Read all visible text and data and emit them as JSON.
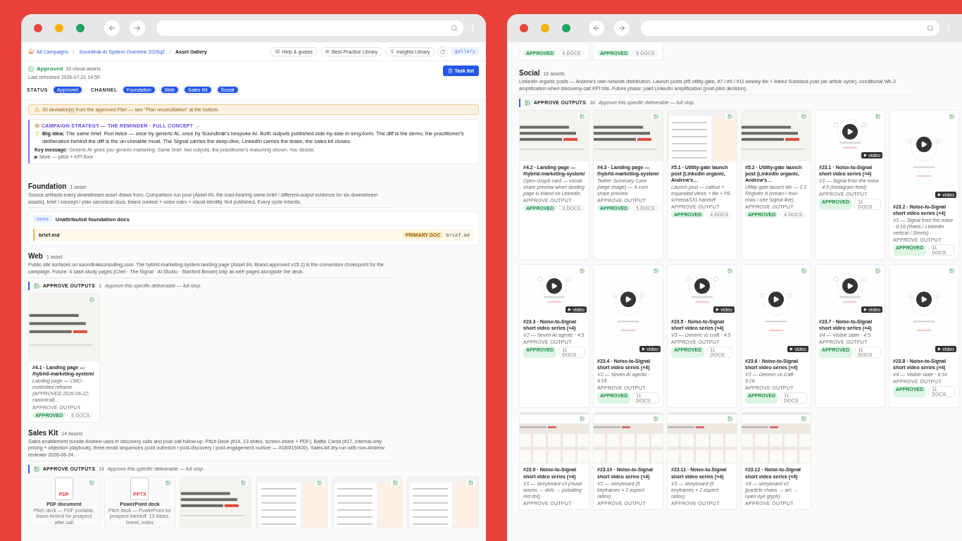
{
  "left_window": {
    "breadcrumbs": [
      "All Campaigns",
      "Soundtrak AI System Overview 2026q2",
      "Asset Gallery"
    ],
    "toolbar_links": [
      "Help & guides",
      "Best-Practice Library",
      "Insights Library"
    ],
    "view_tag": "gallery",
    "status": {
      "label": "Approved",
      "count": "33 visual assets",
      "refreshed": "Last refreshed 2026-07-21 14:50"
    },
    "task_button": "Task list",
    "filters": [
      {
        "label": "STATUS",
        "chips": [
          {
            "label": "Approved",
            "selected": true
          }
        ]
      },
      {
        "label": "CHANNEL",
        "chips": [
          {
            "label": "Foundation",
            "selected": true
          },
          {
            "label": "Web",
            "selected": true
          },
          {
            "label": "Sales Kit",
            "selected": true
          },
          {
            "label": "Social",
            "selected": true
          }
        ]
      }
    ],
    "warning": "30 deviation(s) from the approved Plan — see \"Plan reconciliation\" at the bottom.",
    "strategy": {
      "title": "CAMPAIGN STRATEGY — THE REMINDER · FULL CONCEPT →",
      "big_idea": "**Big idea:** The same brief. Run twice — once by generic AI, once by Soundtrak's bespoke AI. Both outputs published side-by-side in long-form. The diff is the demo; the practitioner's deliberation behind the diff is the un-clonable moat. The Signal carries the deep-dive, LinkedIn carries the tease, the sales kit closes.",
      "key_message": "**Key message:** Generic AI gives you generic marketing. Same brief, two outputs, the practitioner's reasoning shown. You decide.",
      "more": "▶ More — pitch + KPI floor"
    },
    "sections": [
      {
        "title": "Foundation",
        "count": "1 asset",
        "description": "Source artifacts every downstream asset draws from. Comparison run pool (Asset #0, the load-bearing same-brief / different-output evidence for six downstream assets), brief / concept / plan canonical docs, brand context + voice rules + visual identity. Not published. Every cycle inherits.",
        "group": {
          "tag": "none",
          "title": "Unattributed foundation docs",
          "docs": [
            {
              "name": "brief.md",
              "tag": "PRIMARY DOC",
              "file": "brief.md"
            }
          ]
        }
      },
      {
        "title": "Web",
        "count": "1 asset",
        "description": "Public site surfaces on soundtrakconsulting.com. The hybrid-marketing-system landing page (Asset #4, Brand-approved v15.1) is the conversion chokepoint for the campaign. Future: 4 case-study pages (Chef · The Signal · AI Studio · Stanford Brown) ship as web pages alongside the deck.",
        "approve": {
          "label": "APPROVE OUTPUTS",
          "count": "1",
          "note": "Approve this specific deliverable — full stop."
        },
        "cards": [
          {
            "kind": "page",
            "tall": true,
            "title": "#4.1 · Landing page — /hybrid-marketing-system/",
            "subtitle": "Landing page — CMO-controlled reframe (APPROVED 2026-06-22; canonical)…",
            "action": "APPROVE OUTPUT",
            "status": "APPROVED",
            "docs": "6 DOCS"
          }
        ]
      },
      {
        "title": "Sales Kit",
        "count": "14 assets",
        "description": "Sales-enablement bundle Andrew uses in discovery calls and post-call follow-up. Pitch Deck (#14, 13 slides, screen-share + PDF), Battle Cards (#17, internal-only pricing + objection playbook), three email sequences (cold outreach / post-discovery / post-engagement nurture — #18/#19/#20). Sales-kit dry-run with non-Andrew reviewer 2026-06-24.",
        "approve": {
          "label": "APPROVE OUTPUTS",
          "count": "14",
          "note": "Approve this specific deliverable — full stop."
        },
        "cards": [
          {
            "kind": "file",
            "file_type": "PDF",
            "file_label": "PDF document",
            "file_note": "Pitch deck — PDF portable, leave-behind for prospect after call"
          },
          {
            "kind": "file",
            "file_type": "PPTX",
            "file_label": "PowerPoint deck",
            "file_note": "Pitch deck — PowerPoint for prospect handoff; 13 slides, brand, notes"
          },
          {
            "kind": "page"
          },
          {
            "kind": "doc"
          },
          {
            "kind": "doc"
          },
          {
            "kind": "doc"
          }
        ]
      }
    ]
  },
  "right_window": {
    "top_cards": [
      {
        "status": "APPROVED",
        "docs": "4 DOCS"
      },
      {
        "status": "APPROVED",
        "docs": "6 DOCS"
      }
    ],
    "sections": [
      {
        "title": "Social",
        "count": "16 assets",
        "description": "LinkedIn organic posts — Andrew's own network distribution. Launch posts (#5 utility-gate, #7 / #9 / #11 weekly tile + linked Substack post per article cycle), conditional Wk-3 amplification when discovery-call KPI hits. Future phase: paid LinkedIn amplification (post-pilot decision).",
        "approve": {
          "label": "APPROVE OUTPUTS",
          "count": "16",
          "note": "Approve this specific deliverable — full stop."
        },
        "cards": [
          {
            "kind": "page",
            "title": "#4.2 · Landing page — /hybrid-marketing-system/",
            "subtitle": "Open Graph card — social-share preview when landing page is linked on LinkedIn.",
            "action": "APPROVE OUTPUT",
            "status": "APPROVED",
            "docs": "3 DOCS"
          },
          {
            "kind": "page",
            "title": "#4.3 · Landing page — /hybrid-marketing-system/",
            "subtitle": "Twitter Summary Card (large image) — X.com share preview",
            "action": "APPROVE OUTPUT",
            "status": "APPROVED",
            "docs": "5 DOCS"
          },
          {
            "kind": "doc",
            "title": "#5.1 · Utility-gate launch post (LinkedIn organic, Andrew's…",
            "subtitle": "Launch post — callout + expanded views + tile + PE schema/OG handoff",
            "action": "APPROVE OUTPUT",
            "status": "APPROVED",
            "docs": "4 DOCS"
          },
          {
            "kind": "page",
            "title": "#5.2 · Utility-gate launch post (LinkedIn organic, Andrew's…",
            "subtitle": "Utility-gate launch tile — 1:1 Register A (cream / four-rows / one Signal line)",
            "action": "APPROVE OUTPUT",
            "status": "APPROVED",
            "docs": "4 DOCS"
          },
          {
            "kind": "video",
            "video_label": "video",
            "title": "#23.1 · Noise-to-Signal short video series (×4)",
            "subtitle": "V1 — Signal from the noise · 4:5 (Instagram feed)",
            "action": "APPROVE OUTPUT",
            "status": "APPROVED",
            "docs": "11 DOCS"
          },
          {
            "kind": "video",
            "tall": true,
            "video_label": "video",
            "title": "#23.2 · Noise-to-Signal short video series (×4)",
            "subtitle": "V1 — Signal from the noise · 9:16 (Reels / LinkedIn vertical / Shorts)",
            "action": "APPROVE OUTPUT",
            "status": "APPROVED",
            "docs": "11 DOCS"
          },
          {
            "kind": "video",
            "video_label": "video",
            "title": "#23.3 · Noise-to-Signal short video series (×4)",
            "subtitle": "V2 — Seven AI agents · 4:5",
            "action": "APPROVE OUTPUT",
            "status": "APPROVED",
            "docs": "11 DOCS"
          },
          {
            "kind": "video",
            "tall": true,
            "video_label": "video",
            "title": "#23.4 · Noise-to-Signal short video series (×4)",
            "subtitle": "V2 — Seven AI agents · 9:16",
            "action": "APPROVE OUTPUT",
            "status": "APPROVED",
            "docs": "11 DOCS"
          },
          {
            "kind": "video",
            "video_label": "video",
            "title": "#23.5 · Noise-to-Signal short video series (×4)",
            "subtitle": "V3 — Generic vs craft · 4:5",
            "action": "APPROVE OUTPUT",
            "status": "APPROVED",
            "docs": "11 DOCS"
          },
          {
            "kind": "video",
            "tall": true,
            "video_label": "video",
            "title": "#23.6 · Noise-to-Signal short video series (×4)",
            "subtitle": "V3 — Generic vs craft · 9:16",
            "action": "APPROVE OUTPUT",
            "status": "APPROVED",
            "docs": "11 DOCS"
          },
          {
            "kind": "video",
            "video_label": "video",
            "title": "#23.7 · Noise-to-Signal short video series (×4)",
            "subtitle": "V4 — Visible state · 4:5",
            "action": "APPROVE OUTPUT",
            "status": "APPROVED",
            "docs": "11 DOCS"
          },
          {
            "kind": "video",
            "tall": true,
            "video_label": "video",
            "title": "#23.8 · Noise-to-Signal short video series (×4)",
            "subtitle": "V4 — Visible state · 9:16",
            "action": "APPROVE OUTPUT",
            "status": "APPROVED",
            "docs": "11 DOCS"
          },
          {
            "kind": "storyboard",
            "title": "#23.9 · Noise-to-Signal short video series (×4)",
            "subtitle": "V1 — storyboard v3 (music waves → dots → pulsating red dot)",
            "action": "APPROVE OUTPUT"
          },
          {
            "kind": "storyboard",
            "title": "#23.10 · Noise-to-Signal short video series (×4)",
            "subtitle": "V2 — storyboard (5 keyframes × 2 aspect ratios)",
            "action": "APPROVE OUTPUT"
          },
          {
            "kind": "storyboard",
            "title": "#23.11 · Noise-to-Signal short video series (×4)",
            "subtitle": "V3 — storyboard (5 keyframes × 2 aspect ratios)",
            "action": "APPROVE OUTPUT"
          },
          {
            "kind": "storyboard",
            "title": "#23.12 · Noise-to-Signal short video series (×4)",
            "subtitle": "V4 — storyboard v2 (particle chaos → arc → open eye glyph)",
            "action": "APPROVE OUTPUT"
          }
        ]
      }
    ]
  }
}
